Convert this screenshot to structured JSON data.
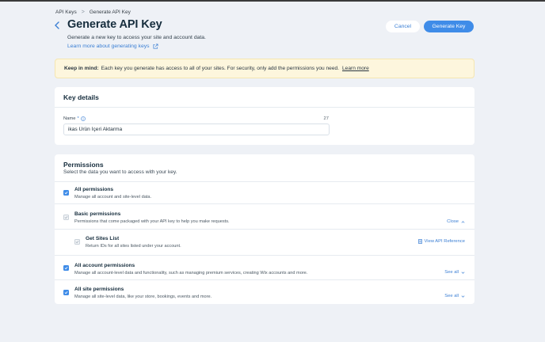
{
  "breadcrumb": {
    "parent": "API Keys",
    "separator": ">",
    "current": "Generate API Key"
  },
  "header": {
    "title": "Generate API Key",
    "subtitle": "Generate a new key to access your site and account data.",
    "learn_link": "Learn more about generating keys"
  },
  "actions": {
    "cancel": "Cancel",
    "generate": "Generate Key"
  },
  "notice": {
    "bold": "Keep in mind:",
    "text": "Each key you generate has access to all of your sites. For security, only add the permissions you need.",
    "link": "Learn more"
  },
  "key_details": {
    "title": "Key details",
    "name_label": "Name",
    "required_mark": "*",
    "char_count": "27",
    "name_value": "ikas Ürün İçeri Aktarma"
  },
  "permissions": {
    "title": "Permissions",
    "subtitle": "Select the data you want to access with your key.",
    "rows": [
      {
        "title": "All permissions",
        "desc": "Manage all account and site-level data.",
        "checked": true,
        "action": ""
      },
      {
        "title": "Basic permissions",
        "desc": "Permissions that come packaged with your API key to help you make requests.",
        "checked": "partial",
        "action": "Close"
      },
      {
        "title": "Get Sites List",
        "desc": "Return IDs for all sites listed under your account.",
        "checked": "partial",
        "action": "View API Reference"
      },
      {
        "title": "All account permissions",
        "desc": "Manage all account-level data and functionality, such as managing premium services, creating Wix accounts and more.",
        "checked": true,
        "action": "See all"
      },
      {
        "title": "All site permissions",
        "desc": "Manage all site-level data, like your store, bookings, events and more.",
        "checked": true,
        "action": "See all"
      }
    ]
  },
  "colors": {
    "accent": "#3f8ce8",
    "link": "#3b7fd4",
    "notice_bg": "#fdf6dd",
    "page_bg": "#eef1f6"
  },
  "icons": {
    "back": "chevron-left-icon",
    "external": "external-link-icon",
    "info": "info-icon",
    "check": "check-icon",
    "chevron": "chevron-down-icon",
    "doc": "document-icon"
  }
}
